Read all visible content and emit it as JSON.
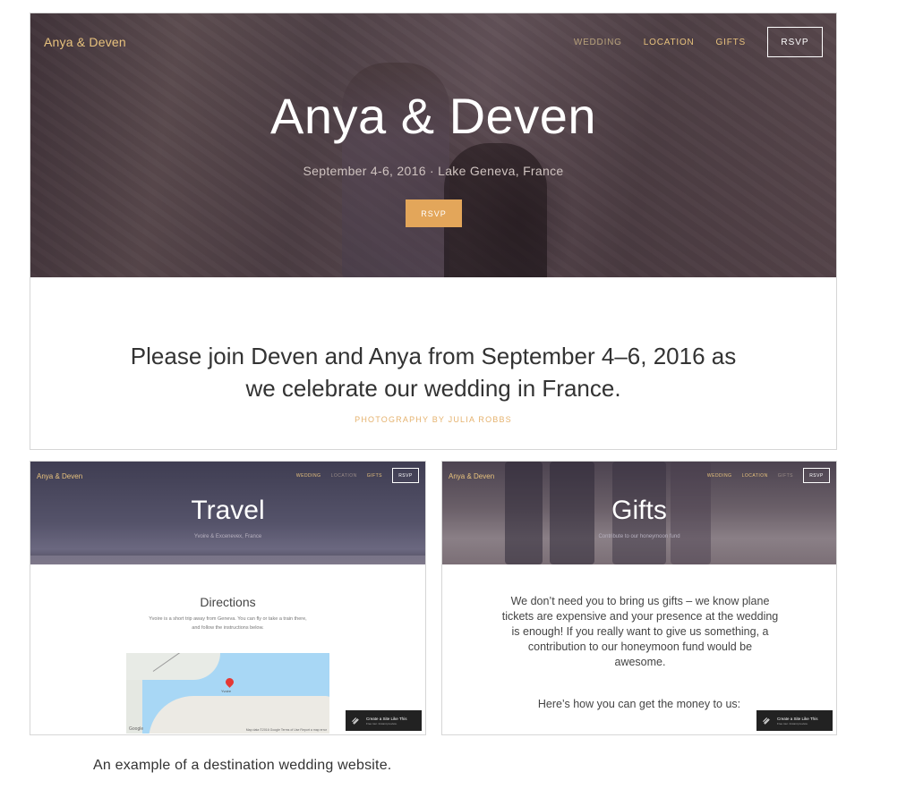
{
  "main": {
    "brand": "Anya & Deven",
    "nav": [
      {
        "label": "WEDDING"
      },
      {
        "label": "LOCATION"
      },
      {
        "label": "GIFTS"
      }
    ],
    "rsvp_label": "RSVP",
    "title": "Anya & Deven",
    "subtitle": "September 4-6, 2016 · Lake Geneva, France",
    "cta_label": "RSVP",
    "intro_line1": "Please join Deven and Anya from September 4–6, 2016 as",
    "intro_line2": "we celebrate our wedding in France.",
    "photo_credit": "PHOTOGRAPHY BY JULIA ROBBS"
  },
  "travel": {
    "brand": "Anya & Deven",
    "nav": [
      {
        "label": "WEDDING"
      },
      {
        "label": "LOCATION"
      },
      {
        "label": "GIFTS"
      }
    ],
    "rsvp_label": "RSVP",
    "title": "Travel",
    "subtitle": "Yvoire & Excenevex, France",
    "directions_title": "Directions",
    "directions_line1": "Yvoire is a short trip away from Geneva. You can fly or take a train there,",
    "directions_line2": "and follow the instructions below.",
    "map": {
      "google": "Google",
      "terms": "Map data ©2016 Google   Terms of Use   Report a map error",
      "pin_label": "Yvoire"
    },
    "cta_main": "Create a Site Like This",
    "cta_sub": "Free tour. Instant preview."
  },
  "gifts": {
    "brand": "Anya & Deven",
    "nav": [
      {
        "label": "WEDDING"
      },
      {
        "label": "LOCATION"
      },
      {
        "label": "GIFTS"
      }
    ],
    "rsvp_label": "RSVP",
    "title": "Gifts",
    "subtitle": "Contribute to our honeymoon fund",
    "body_line1": "We don’t need you to bring us gifts – we know plane",
    "body_line2": "tickets are expensive and your presence at the wedding",
    "body_line3": "is enough! If you really want to give us something, a",
    "body_line4": "contribution to our honeymoon fund would be",
    "body_line5": "awesome.",
    "how": "Here’s how you can get the money to us:",
    "cta_main": "Create a Site Like This",
    "cta_sub": "Free tour. Instant preview."
  },
  "caption": "An example of a destination wedding website.",
  "colors": {
    "accent_gold": "#e8c27d",
    "button_orange": "#e3a65a",
    "cta_dark": "#222222"
  },
  "icons": {
    "cta": "squarespace-logo-icon",
    "map_pin": "map-pin-icon"
  }
}
